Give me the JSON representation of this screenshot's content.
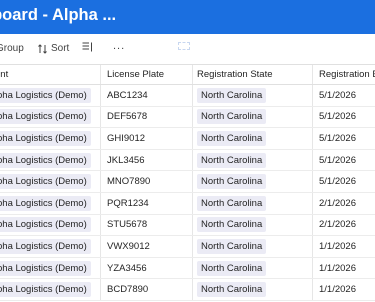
{
  "header": {
    "title": "hboard - Alpha ..."
  },
  "toolbar": {
    "group_label": "Group",
    "sort_label": "Sort",
    "more_label": "..."
  },
  "table": {
    "columns": [
      "ent",
      "License Plate",
      "Registration State",
      "Registration Ex"
    ],
    "rows": [
      {
        "agent": "pha Logistics (Demo)",
        "plate": "ABC1234",
        "state": "North Carolina",
        "exp": "5/1/2026"
      },
      {
        "agent": "pha Logistics (Demo)",
        "plate": "DEF5678",
        "state": "North Carolina",
        "exp": "5/1/2026"
      },
      {
        "agent": "pha Logistics (Demo)",
        "plate": "GHI9012",
        "state": "North Carolina",
        "exp": "5/1/2026"
      },
      {
        "agent": "pha Logistics (Demo)",
        "plate": "JKL3456",
        "state": "North Carolina",
        "exp": "5/1/2026"
      },
      {
        "agent": "pha Logistics (Demo)",
        "plate": "MNO7890",
        "state": "North Carolina",
        "exp": "5/1/2026"
      },
      {
        "agent": "pha Logistics (Demo)",
        "plate": "PQR1234",
        "state": "North Carolina",
        "exp": "2/1/2026"
      },
      {
        "agent": "pha Logistics (Demo)",
        "plate": "STU5678",
        "state": "North Carolina",
        "exp": "2/1/2026"
      },
      {
        "agent": "pha Logistics (Demo)",
        "plate": "VWX9012",
        "state": "North Carolina",
        "exp": "1/1/2026"
      },
      {
        "agent": "pha Logistics (Demo)",
        "plate": "YZA3456",
        "state": "North Carolina",
        "exp": "1/1/2026"
      },
      {
        "agent": "pha Logistics (Demo)",
        "plate": "BCD7890",
        "state": "North Carolina",
        "exp": "1/1/2026"
      }
    ]
  },
  "colors": {
    "header_bg": "#1b6fe0",
    "chip_bg": "#ebebf5",
    "border": "#e0e0e0"
  }
}
